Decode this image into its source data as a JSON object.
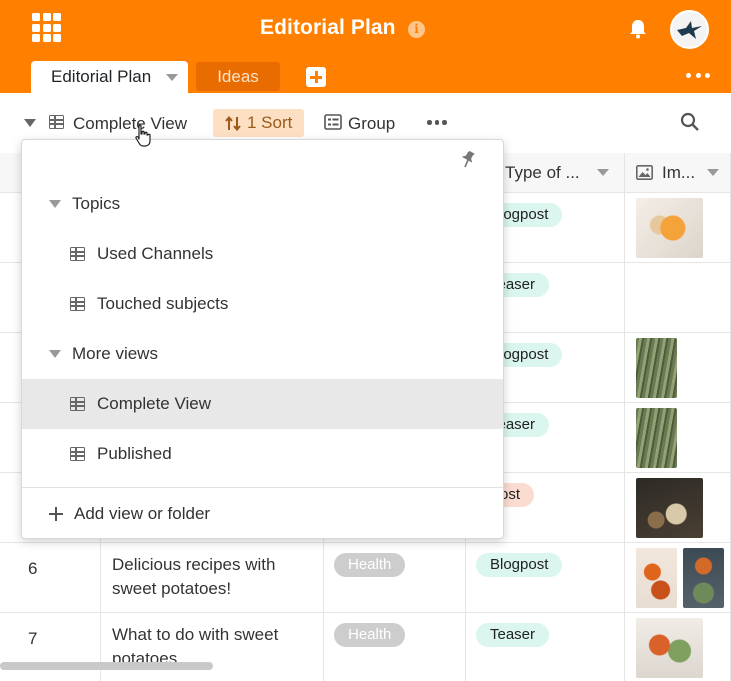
{
  "header": {
    "title": "Editorial Plan",
    "apps_icon": "apps-grid-icon",
    "info_icon_text": "i",
    "bell_icon": "bell-icon",
    "avatar_icon": "avatar",
    "accent_color": "#ff8000"
  },
  "tabs": {
    "active": "Editorial Plan",
    "second": "Ideas",
    "add_icon": "plus-icon",
    "more_icon": "more-icon"
  },
  "toolbar": {
    "view_name": "Complete View",
    "sort_label": "1 Sort",
    "group_label": "Group",
    "more_icon": "more-icon",
    "search_icon": "search-icon"
  },
  "columns": {
    "type": "Type of ...",
    "image": "Im..."
  },
  "rows": [
    {
      "num": "",
      "title": "",
      "tag": "",
      "type": "Blogpost"
    },
    {
      "num": "",
      "title": "",
      "tag": "",
      "type": "Teaser"
    },
    {
      "num": "",
      "title": "",
      "tag": "",
      "type": "Blogpost"
    },
    {
      "num": "",
      "title": "",
      "tag": "",
      "type": "Teaser"
    },
    {
      "num": "",
      "title": "",
      "tag": "",
      "type": "Post"
    },
    {
      "num": "6",
      "title_line1": "Delicious recipes with",
      "title_line2": "sweet potatoes!",
      "tag": "Health",
      "type": "Blogpost"
    },
    {
      "num": "7",
      "title_line1": "What to do with sweet",
      "title_line2": "potatoes",
      "tag": "Health",
      "type": "Teaser"
    }
  ],
  "dropdown": {
    "folder1": "Topics",
    "folder1_items": [
      "Used Channels",
      "Touched subjects"
    ],
    "folder2": "More views",
    "folder2_items": [
      "Complete View",
      "Published"
    ],
    "add_label": "Add view or folder"
  },
  "colors": {
    "header_bg": "#ff8000",
    "sort_chip_bg": "#fddfc4",
    "pill_mint": "#dbf5ef",
    "pill_peach": "#fbdcd0",
    "pill_grey": "#cdcdcd"
  }
}
